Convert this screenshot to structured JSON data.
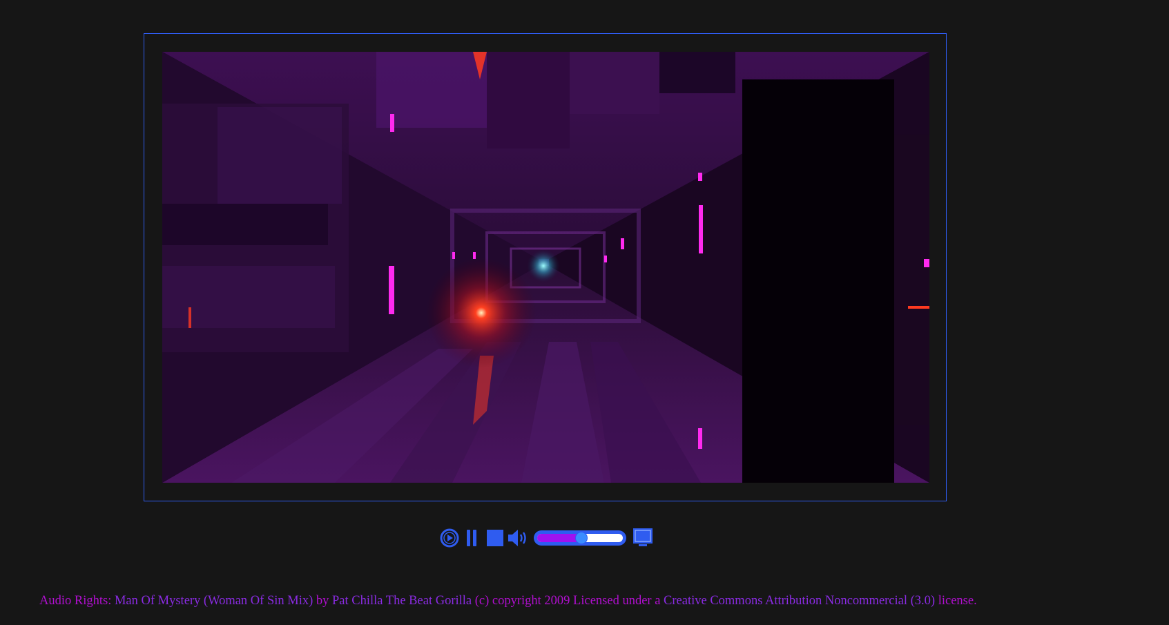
{
  "player": {
    "video_description_icon": "sci-fi-tunnel-video-frame",
    "controls": {
      "replay_icon": "replay-icon",
      "pause_icon": "pause-icon",
      "stop_icon": "stop-icon",
      "volume_icon": "volume-icon",
      "fullscreen_icon": "fullscreen-monitor-icon",
      "volume_level": 0.52
    },
    "colors": {
      "accent": "#2f5cf0",
      "volume_fill": "#a012f0",
      "volume_thumb": "#3a8cff"
    }
  },
  "credits": {
    "prefix": "Audio Rights: ",
    "track_link": "Man Of Mystery (Woman Of Sin Mix)",
    "by_text": " by ",
    "artist_link": "Pat Chilla The Beat Gorilla",
    "middle_text": " (c) copyright 2009 Licensed under a ",
    "license_link": "Creative Commons Attribution Noncommercial  (3.0)",
    "suffix": " license.",
    "colors": {
      "text": "#b10fd0",
      "link": "#8a2be2"
    }
  }
}
